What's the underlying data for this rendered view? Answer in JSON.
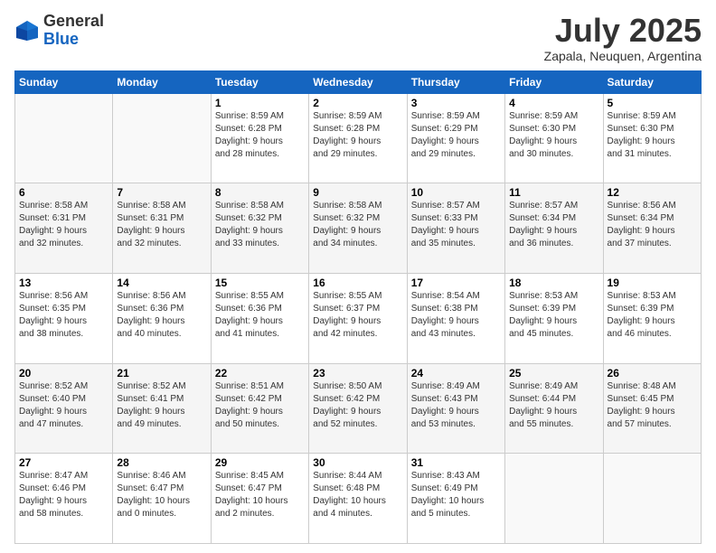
{
  "header": {
    "logo_general": "General",
    "logo_blue": "Blue",
    "month_title": "July 2025",
    "location": "Zapala, Neuquen, Argentina"
  },
  "days_of_week": [
    "Sunday",
    "Monday",
    "Tuesday",
    "Wednesday",
    "Thursday",
    "Friday",
    "Saturday"
  ],
  "weeks": [
    [
      {
        "day": "",
        "info": ""
      },
      {
        "day": "",
        "info": ""
      },
      {
        "day": "1",
        "info": "Sunrise: 8:59 AM\nSunset: 6:28 PM\nDaylight: 9 hours\nand 28 minutes."
      },
      {
        "day": "2",
        "info": "Sunrise: 8:59 AM\nSunset: 6:28 PM\nDaylight: 9 hours\nand 29 minutes."
      },
      {
        "day": "3",
        "info": "Sunrise: 8:59 AM\nSunset: 6:29 PM\nDaylight: 9 hours\nand 29 minutes."
      },
      {
        "day": "4",
        "info": "Sunrise: 8:59 AM\nSunset: 6:30 PM\nDaylight: 9 hours\nand 30 minutes."
      },
      {
        "day": "5",
        "info": "Sunrise: 8:59 AM\nSunset: 6:30 PM\nDaylight: 9 hours\nand 31 minutes."
      }
    ],
    [
      {
        "day": "6",
        "info": "Sunrise: 8:58 AM\nSunset: 6:31 PM\nDaylight: 9 hours\nand 32 minutes."
      },
      {
        "day": "7",
        "info": "Sunrise: 8:58 AM\nSunset: 6:31 PM\nDaylight: 9 hours\nand 32 minutes."
      },
      {
        "day": "8",
        "info": "Sunrise: 8:58 AM\nSunset: 6:32 PM\nDaylight: 9 hours\nand 33 minutes."
      },
      {
        "day": "9",
        "info": "Sunrise: 8:58 AM\nSunset: 6:32 PM\nDaylight: 9 hours\nand 34 minutes."
      },
      {
        "day": "10",
        "info": "Sunrise: 8:57 AM\nSunset: 6:33 PM\nDaylight: 9 hours\nand 35 minutes."
      },
      {
        "day": "11",
        "info": "Sunrise: 8:57 AM\nSunset: 6:34 PM\nDaylight: 9 hours\nand 36 minutes."
      },
      {
        "day": "12",
        "info": "Sunrise: 8:56 AM\nSunset: 6:34 PM\nDaylight: 9 hours\nand 37 minutes."
      }
    ],
    [
      {
        "day": "13",
        "info": "Sunrise: 8:56 AM\nSunset: 6:35 PM\nDaylight: 9 hours\nand 38 minutes."
      },
      {
        "day": "14",
        "info": "Sunrise: 8:56 AM\nSunset: 6:36 PM\nDaylight: 9 hours\nand 40 minutes."
      },
      {
        "day": "15",
        "info": "Sunrise: 8:55 AM\nSunset: 6:36 PM\nDaylight: 9 hours\nand 41 minutes."
      },
      {
        "day": "16",
        "info": "Sunrise: 8:55 AM\nSunset: 6:37 PM\nDaylight: 9 hours\nand 42 minutes."
      },
      {
        "day": "17",
        "info": "Sunrise: 8:54 AM\nSunset: 6:38 PM\nDaylight: 9 hours\nand 43 minutes."
      },
      {
        "day": "18",
        "info": "Sunrise: 8:53 AM\nSunset: 6:39 PM\nDaylight: 9 hours\nand 45 minutes."
      },
      {
        "day": "19",
        "info": "Sunrise: 8:53 AM\nSunset: 6:39 PM\nDaylight: 9 hours\nand 46 minutes."
      }
    ],
    [
      {
        "day": "20",
        "info": "Sunrise: 8:52 AM\nSunset: 6:40 PM\nDaylight: 9 hours\nand 47 minutes."
      },
      {
        "day": "21",
        "info": "Sunrise: 8:52 AM\nSunset: 6:41 PM\nDaylight: 9 hours\nand 49 minutes."
      },
      {
        "day": "22",
        "info": "Sunrise: 8:51 AM\nSunset: 6:42 PM\nDaylight: 9 hours\nand 50 minutes."
      },
      {
        "day": "23",
        "info": "Sunrise: 8:50 AM\nSunset: 6:42 PM\nDaylight: 9 hours\nand 52 minutes."
      },
      {
        "day": "24",
        "info": "Sunrise: 8:49 AM\nSunset: 6:43 PM\nDaylight: 9 hours\nand 53 minutes."
      },
      {
        "day": "25",
        "info": "Sunrise: 8:49 AM\nSunset: 6:44 PM\nDaylight: 9 hours\nand 55 minutes."
      },
      {
        "day": "26",
        "info": "Sunrise: 8:48 AM\nSunset: 6:45 PM\nDaylight: 9 hours\nand 57 minutes."
      }
    ],
    [
      {
        "day": "27",
        "info": "Sunrise: 8:47 AM\nSunset: 6:46 PM\nDaylight: 9 hours\nand 58 minutes."
      },
      {
        "day": "28",
        "info": "Sunrise: 8:46 AM\nSunset: 6:47 PM\nDaylight: 10 hours\nand 0 minutes."
      },
      {
        "day": "29",
        "info": "Sunrise: 8:45 AM\nSunset: 6:47 PM\nDaylight: 10 hours\nand 2 minutes."
      },
      {
        "day": "30",
        "info": "Sunrise: 8:44 AM\nSunset: 6:48 PM\nDaylight: 10 hours\nand 4 minutes."
      },
      {
        "day": "31",
        "info": "Sunrise: 8:43 AM\nSunset: 6:49 PM\nDaylight: 10 hours\nand 5 minutes."
      },
      {
        "day": "",
        "info": ""
      },
      {
        "day": "",
        "info": ""
      }
    ]
  ]
}
